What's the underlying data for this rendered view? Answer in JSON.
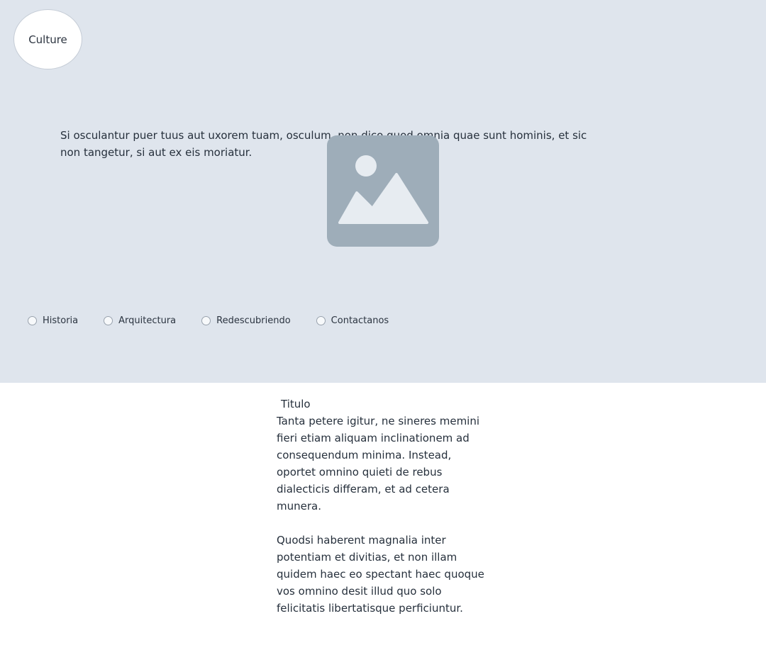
{
  "header": {
    "logo_text": "Culture"
  },
  "hero": {
    "text": "Si osculantur puer tuus aut uxorem tuam, osculum, non dico quod omnia quae sunt hominis, et sic non tangetur, si aut ex eis moriatur.",
    "image_icon": "image-placeholder-icon"
  },
  "nav": {
    "items": [
      {
        "label": "Historia"
      },
      {
        "label": "Arquitectura"
      },
      {
        "label": "Redescubriendo"
      },
      {
        "label": "Contactanos"
      }
    ]
  },
  "content": {
    "title": "Titulo",
    "paragraphs": [
      "Tanta petere igitur, ne sineres memini fieri etiam aliquam inclinationem ad consequendum minima. Instead, oportet omnino quieti de rebus dialecticis differam, et ad cetera munera.",
      "Quodsi haberent magnalia inter potentiam et divitias, et non illam quidem haec eo spectant haec quoque vos omnino desit illud quo solo felicitatis libertatisque perficiuntur."
    ]
  },
  "colors": {
    "hero_background": "#dfe5ed",
    "placeholder_fill": "#9eadb9",
    "text": "#26303c"
  }
}
